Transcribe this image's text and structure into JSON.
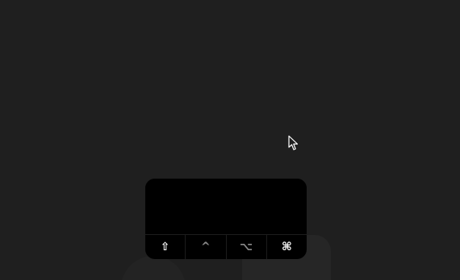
{
  "keyboard_overlay": {
    "modifiers": [
      {
        "name": "shift",
        "glyph": "⇧",
        "icon": "shift-icon",
        "active": true
      },
      {
        "name": "control",
        "glyph": "^",
        "icon": "control-icon",
        "active": false
      },
      {
        "name": "option",
        "glyph": "⌥",
        "icon": "option-icon",
        "active": false
      },
      {
        "name": "command",
        "glyph": "⌘",
        "icon": "command-icon",
        "active": true
      }
    ]
  },
  "colors": {
    "background": "#1f1f1f",
    "overlay": "#000000",
    "active_key": "#ffffff",
    "inactive_key": "#8a8a8a"
  }
}
